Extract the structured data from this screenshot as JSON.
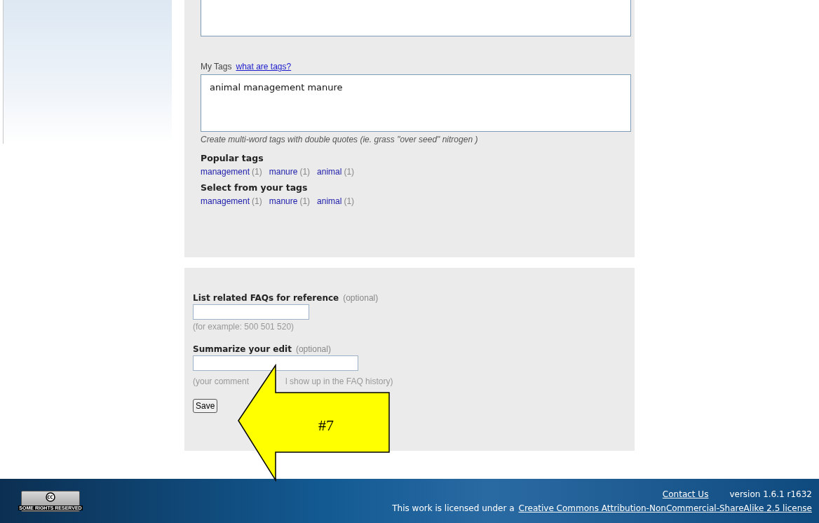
{
  "tags_section": {
    "label": "My Tags",
    "help_link": "what are tags?",
    "value": "animal management manure",
    "hint": "Create multi-word tags with double quotes (ie. grass \"over seed\" nitrogen )",
    "popular_heading": "Popular tags",
    "popular_tags": [
      {
        "name": "management",
        "count": "(1)"
      },
      {
        "name": "manure",
        "count": "(1)"
      },
      {
        "name": "animal",
        "count": "(1)"
      }
    ],
    "your_heading": "Select from your tags",
    "your_tags": [
      {
        "name": "management",
        "count": "(1)"
      },
      {
        "name": "manure",
        "count": "(1)"
      },
      {
        "name": "animal",
        "count": "(1)"
      }
    ]
  },
  "edit_section": {
    "faq_label": "List related FAQs for reference",
    "faq_optional": "(optional)",
    "faq_hint": "(for example: 500 501 520)",
    "summary_label": "Summarize your edit",
    "summary_optional": "(optional)",
    "summary_hint_parts": [
      "(your comment",
      "l show up in the FAQ history)"
    ],
    "save_button": "Save"
  },
  "annotation": {
    "label": "#7"
  },
  "footer": {
    "badge": "SOME RIGHTS RESERVED",
    "contact_link": "Contact Us",
    "version": "version 1.6.1 r1632",
    "license_prefix": "This work is licensed under a",
    "license_link": "Creative Commons Attribution-NonCommercial-ShareAlike 2.5 license"
  }
}
